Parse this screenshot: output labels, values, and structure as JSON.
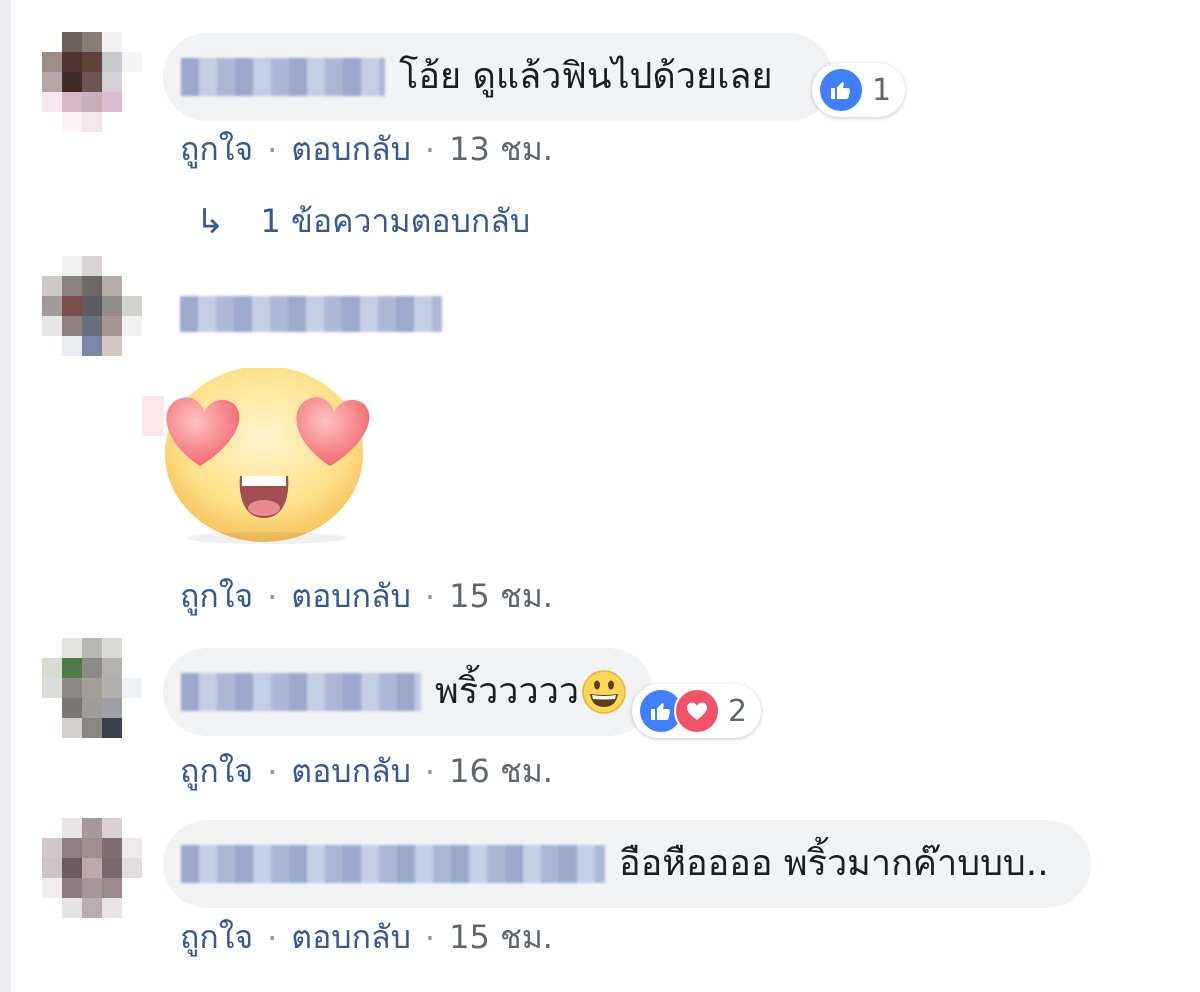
{
  "comments": [
    {
      "text": "โอ้ย ดูแล้วฟินไปด้วยเลย",
      "actions": {
        "like": "ถูกใจ",
        "reply": "ตอบกลับ",
        "time": "13 ชม."
      },
      "reactions": {
        "count": "1",
        "types": [
          "like-icon"
        ]
      },
      "replies_link": "1 ข้อความตอบกลับ"
    },
    {
      "sticker": "heart-eyes-emoji",
      "actions": {
        "like": "ถูกใจ",
        "reply": "ตอบกลับ",
        "time": "15 ชม."
      }
    },
    {
      "text": "พริ้ววววว",
      "inline_emoji": "grinning-emoji",
      "actions": {
        "like": "ถูกใจ",
        "reply": "ตอบกลับ",
        "time": "16 ชม."
      },
      "reactions": {
        "count": "2",
        "types": [
          "like-icon",
          "love-icon"
        ]
      }
    },
    {
      "text": "อือหืออออ พริ้วมากค๊าบบบ..",
      "actions": {
        "like": "ถูกใจ",
        "reply": "ตอบกลับ",
        "time": "15 ชม."
      }
    }
  ],
  "separator": "·",
  "colors": {
    "link": "#385898",
    "bubble": "#f2f3f5",
    "like": "#4080ff",
    "love": "#f25268"
  }
}
